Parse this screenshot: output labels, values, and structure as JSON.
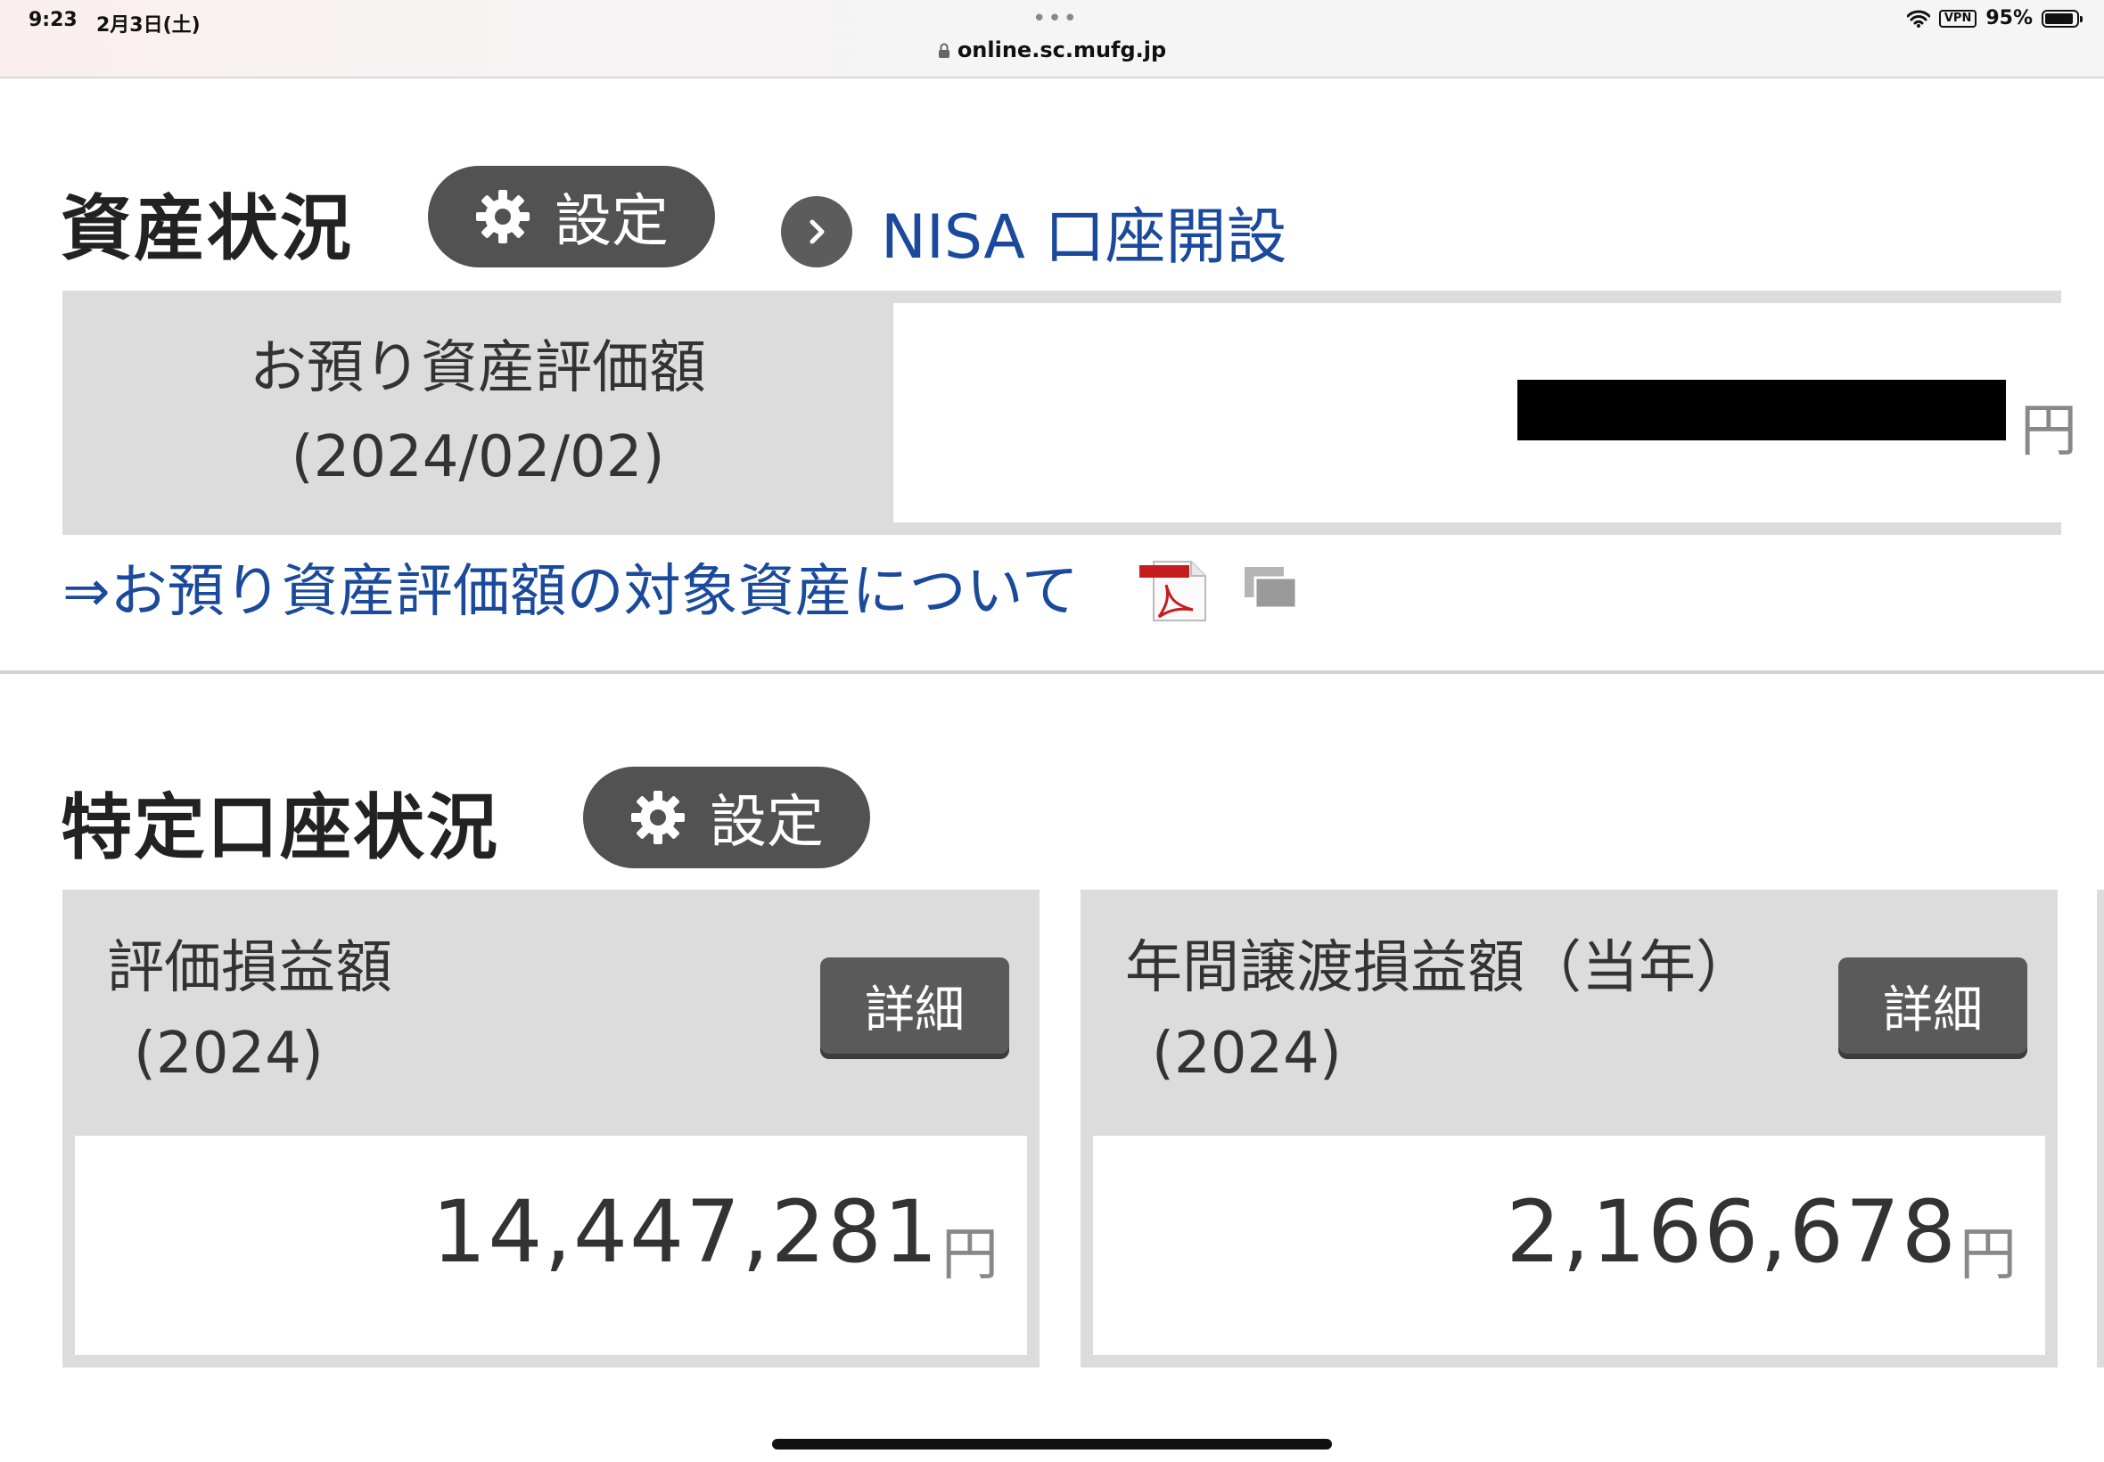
{
  "status_bar": {
    "time": "9:23",
    "date": "2月3日(土)",
    "url": "online.sc.mufg.jp",
    "vpn": "VPN",
    "battery": "95%"
  },
  "asset_section": {
    "title": "資産状況",
    "settings_label": "設定",
    "nisa_link": "NISA 口座開設",
    "label_line1": "お預り資産評価額",
    "label_line2": "(2024/02/02)",
    "value_redacted": true,
    "yen": "円",
    "about_link": "⇒お預り資産評価額の対象資産について"
  },
  "tokutei_section": {
    "title": "特定口座状況",
    "settings_label": "設定",
    "cards": [
      {
        "title": "評価損益額",
        "year": "(2024)",
        "detail_label": "詳細",
        "value": "14,447,281",
        "yen": "円"
      },
      {
        "title": "年間譲渡損益額（当年）",
        "year": "(2024)",
        "detail_label": "詳細",
        "value": "2,166,678",
        "yen": "円"
      }
    ]
  },
  "colors": {
    "link": "#1b4a9c",
    "button_dark": "#525252",
    "panel_gray": "#dcdcdc"
  },
  "icons": [
    "lock-icon",
    "wifi-icon",
    "battery-icon",
    "gear-icon",
    "chevron-right-icon",
    "pdf-icon",
    "new-window-icon"
  ]
}
